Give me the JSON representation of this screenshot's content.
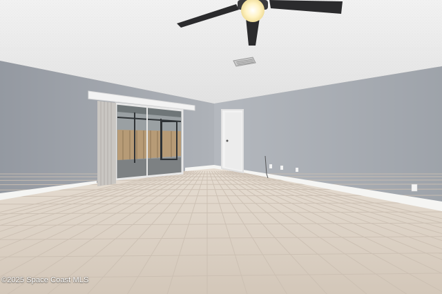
{
  "photo": {
    "watermark": "©2025 Space Coast MLS"
  },
  "colors": {
    "ceiling": "#ededed",
    "wall_left": "#9ea3ab",
    "wall_back": "#b3b7bd",
    "wall_right": "#a8adb4",
    "floor": "#ddd3c8",
    "grout": "#c7bcae",
    "baseboard": "#f4f4f2",
    "fan_blade": "#2b2b2d",
    "fan_light": "#fff6d6"
  }
}
